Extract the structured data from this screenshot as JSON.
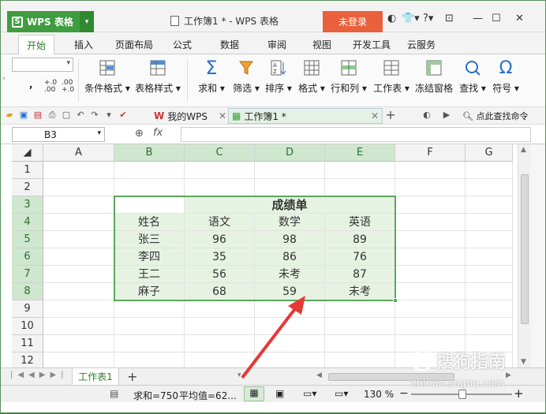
{
  "app": {
    "name": "WPS 表格",
    "doc_title": "工作簿1 * - WPS 表格",
    "login": "未登录"
  },
  "menu": {
    "tabs": [
      "开始",
      "插入",
      "页面布局",
      "公式",
      "数据",
      "审阅",
      "视图",
      "开发工具",
      "云服务"
    ]
  },
  "ribbon": {
    "small_labels": [
      "+.0\n.00",
      ".00\n+.0"
    ],
    "buttons": [
      {
        "label": "条件格式 ▾",
        "icon": "conditional-format-icon"
      },
      {
        "label": "表格样式 ▾",
        "icon": "table-style-icon"
      },
      {
        "label": "求和 ▾",
        "icon": "sigma-icon"
      },
      {
        "label": "筛选 ▾",
        "icon": "filter-icon"
      },
      {
        "label": "排序 ▾",
        "icon": "sort-icon"
      },
      {
        "label": "格式 ▾",
        "icon": "format-icon"
      },
      {
        "label": "行和列 ▾",
        "icon": "rows-cols-icon"
      },
      {
        "label": "工作表 ▾",
        "icon": "worksheet-icon"
      },
      {
        "label": "冻结窗格",
        "icon": "freeze-panes-icon"
      },
      {
        "label": "查找 ▾",
        "icon": "find-icon"
      },
      {
        "label": "符号 ▾",
        "icon": "omega-icon"
      }
    ]
  },
  "doc_tabs": {
    "wps": "我的WPS",
    "book": "工作簿1 *",
    "search": "点此查找命令"
  },
  "formula": {
    "cell_ref": "B3",
    "fx": "fx",
    "value": ""
  },
  "columns": [
    "A",
    "B",
    "C",
    "D",
    "E",
    "F",
    "G"
  ],
  "rows": [
    "1",
    "2",
    "3",
    "4",
    "5",
    "6",
    "7",
    "8",
    "9",
    "10",
    "11",
    "12"
  ],
  "table": {
    "title": "成绩单",
    "header": [
      "姓名",
      "语文",
      "数学",
      "英语"
    ],
    "data": [
      [
        "张三",
        "96",
        "98",
        "89"
      ],
      [
        "李四",
        "35",
        "86",
        "76"
      ],
      [
        "王二",
        "56",
        "未考",
        "87"
      ],
      [
        "麻子",
        "68",
        "59",
        "未考"
      ]
    ]
  },
  "sheet_tab": "工作表1",
  "status": {
    "sum": "求和=750",
    "avg": "平均值=62...",
    "zoom": "130 %",
    "minus": "−",
    "plus": "+"
  },
  "watermark": {
    "brand": "搜狗指南",
    "url": "zhinan.sogou.com"
  },
  "colors": {
    "accent": "#3f9d3f",
    "login": "#e8613c",
    "table_fill": "#e6f3e2",
    "arrow": "#e53935"
  }
}
